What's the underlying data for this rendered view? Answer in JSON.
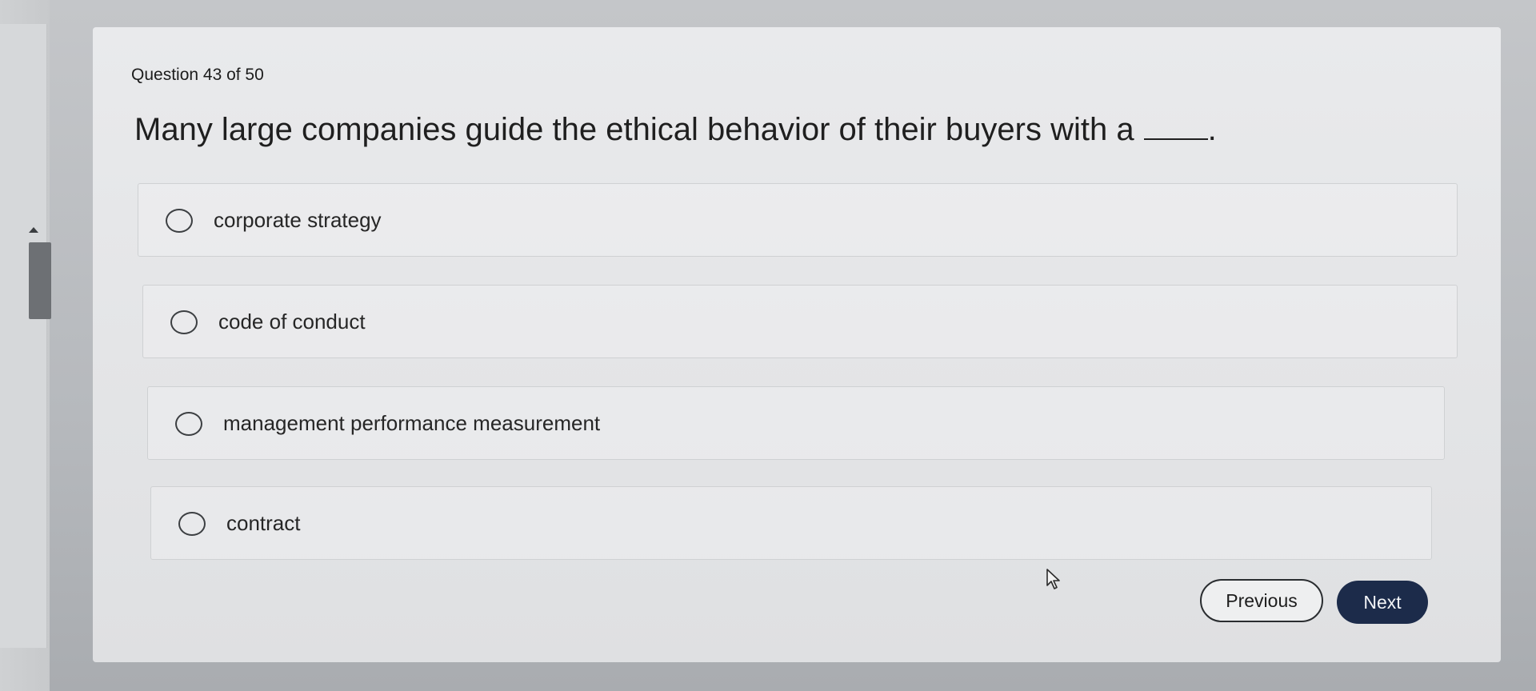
{
  "question": {
    "number_label": "Question 43 of 50",
    "text": "Many large companies guide the ethical behavior of their buyers with a",
    "blank_suffix": "."
  },
  "options": [
    {
      "label": "corporate strategy",
      "selected": false
    },
    {
      "label": "code of conduct",
      "selected": false
    },
    {
      "label": "management performance measurement",
      "selected": false
    },
    {
      "label": "contract",
      "selected": false
    }
  ],
  "navigation": {
    "previous_label": "Previous",
    "next_label": "Next"
  },
  "colors": {
    "next_button_bg": "#1c2b4a",
    "card_bg": "#e6e7e9"
  },
  "icons": {
    "cursor": "mouse-pointer-icon",
    "scroll_up": "scroll-up-arrow-icon"
  }
}
